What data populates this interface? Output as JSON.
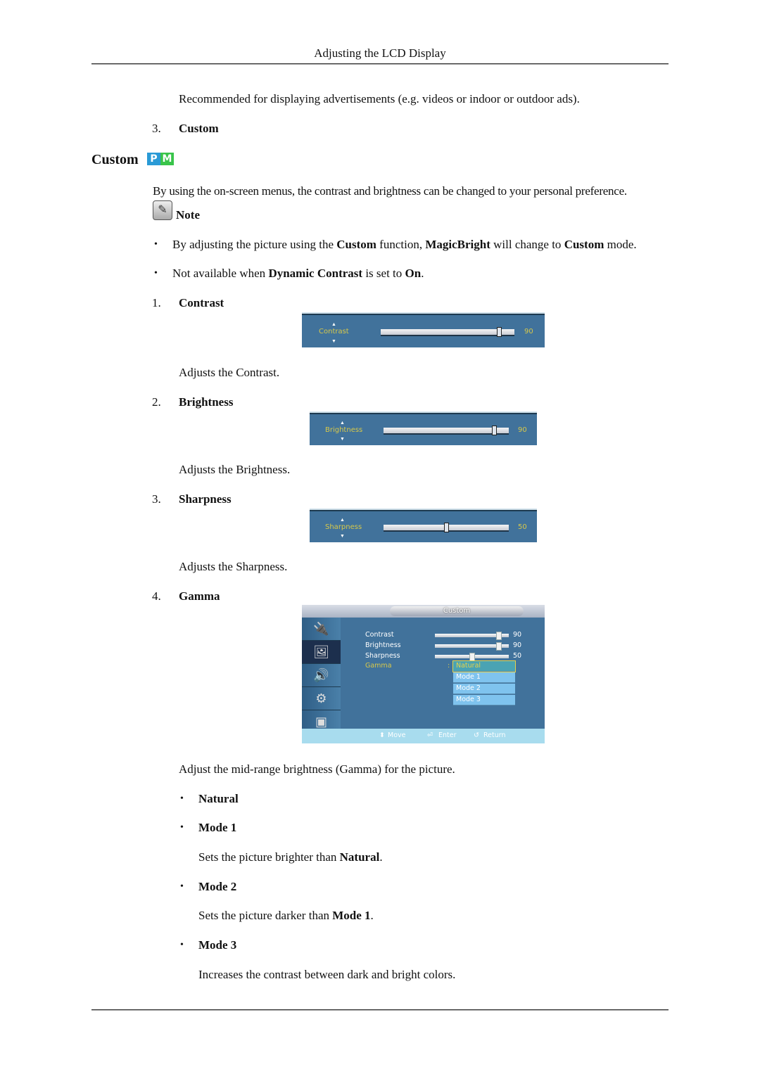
{
  "header": {
    "title": "Adjusting the LCD Display"
  },
  "intro": {
    "recommended_text": "Recommended for displaying advertisements (e.g. videos or indoor or outdoor ads).",
    "item_number": "3.",
    "item_label": "Custom"
  },
  "section": {
    "title": "Custom",
    "badge_p": "P",
    "badge_m": "M",
    "badge_p_color": "#2a9ad6",
    "badge_m_color": "#39c44a",
    "description": "By using the on-screen menus, the contrast and brightness can be changed to your personal preference."
  },
  "note": {
    "label": "Note",
    "bullets": [
      {
        "parts": [
          "By adjusting the picture using the ",
          "Custom",
          " function, ",
          "MagicBright",
          " will change to ",
          "Custom",
          " mode."
        ]
      },
      {
        "parts": [
          "Not available when ",
          "Dynamic Contrast",
          " is set to ",
          "On",
          "."
        ]
      }
    ]
  },
  "items": [
    {
      "number": "1.",
      "label": "Contrast",
      "description": "Adjusts the Contrast.",
      "osd": {
        "label": "Contrast",
        "value": "90",
        "fraction": 0.9
      }
    },
    {
      "number": "2.",
      "label": "Brightness",
      "description": "Adjusts the Brightness.",
      "osd": {
        "label": "Brightness",
        "value": "90",
        "fraction": 0.9
      }
    },
    {
      "number": "3.",
      "label": "Sharpness",
      "description": "Adjusts the Sharpness.",
      "osd": {
        "label": "Sharpness",
        "value": "50",
        "fraction": 0.5
      }
    },
    {
      "number": "4.",
      "label": "Gamma",
      "description": "Adjust the mid-range brightness (Gamma) for the picture."
    }
  ],
  "gamma_osd": {
    "title": "Custom",
    "rows": [
      {
        "label": "Contrast",
        "value": "90",
        "fraction": 0.9
      },
      {
        "label": "Brightness",
        "value": "90",
        "fraction": 0.9
      },
      {
        "label": "Sharpness",
        "value": "50",
        "fraction": 0.5
      }
    ],
    "gamma_label": "Gamma",
    "gamma_colon": ":",
    "options": [
      "Natural",
      "Mode 1",
      "Mode 2",
      "Mode 3"
    ],
    "selected": "Natural",
    "side_icons": [
      "input-icon",
      "picture-icon",
      "sound-icon",
      "setup-icon",
      "multi-control-icon"
    ],
    "footer": {
      "move": "Move",
      "enter": "Enter",
      "return": "Return"
    }
  },
  "gamma_modes": [
    {
      "label": "Natural"
    },
    {
      "label": "Mode 1",
      "desc_parts": [
        "Sets the picture brighter than ",
        "Natural",
        "."
      ]
    },
    {
      "label": "Mode 2",
      "desc_parts": [
        "Sets the picture darker than ",
        "Mode 1",
        "."
      ]
    },
    {
      "label": "Mode 3",
      "desc": "Increases the contrast between dark and bright colors."
    }
  ]
}
